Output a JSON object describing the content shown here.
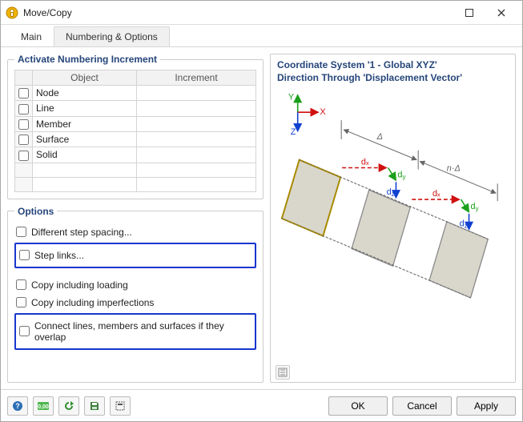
{
  "title": "Move/Copy",
  "tabs": {
    "main": "Main",
    "numbering": "Numbering & Options"
  },
  "numbering": {
    "legend": "Activate Numbering Increment",
    "headers": {
      "object": "Object",
      "increment": "Increment"
    },
    "rows": [
      "Node",
      "Line",
      "Member",
      "Surface",
      "Solid"
    ]
  },
  "options": {
    "legend": "Options",
    "different_step": "Different step spacing...",
    "step_links": "Step links...",
    "copy_loading": "Copy including loading",
    "copy_imperfections": "Copy including imperfections",
    "connect": "Connect lines, members and surfaces if they overlap"
  },
  "preview": {
    "line1": "Coordinate System '1 - Global XYZ'",
    "line2": "Direction Through 'Displacement Vector'"
  },
  "buttons": {
    "ok": "OK",
    "cancel": "Cancel",
    "apply": "Apply"
  }
}
